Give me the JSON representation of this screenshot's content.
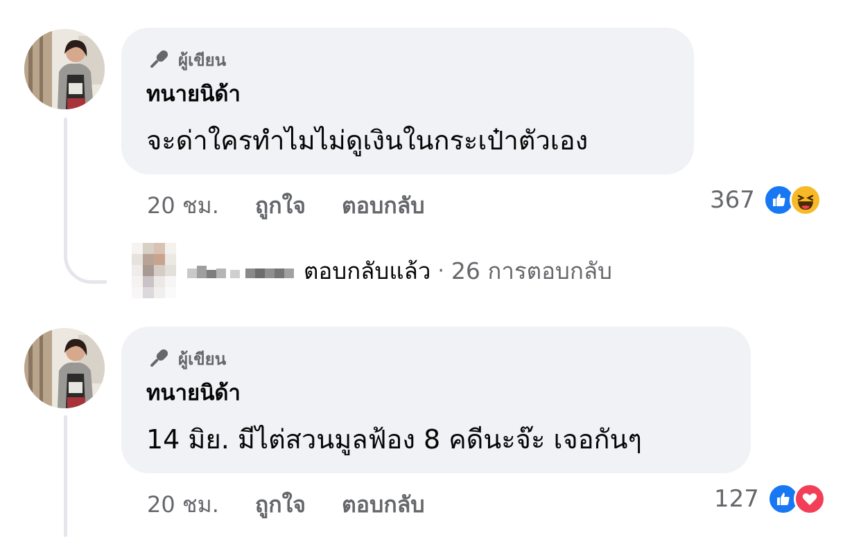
{
  "comments": [
    {
      "badge": "ผู้เขียน",
      "author": "ทนายนิด้า",
      "text": "จะด่าใครทำไมไม่ดูเงินในกระเป๋าตัวเอง",
      "time": "20 ชม.",
      "like_label": "ถูกใจ",
      "reply_label": "ตอบกลับ",
      "reaction_count": "367",
      "reactions": [
        "like-reaction-icon",
        "haha-reaction-icon"
      ]
    },
    {
      "badge": "ผู้เขียน",
      "author": "ทนายนิด้า",
      "text": "14 มิย. มีไต่สวนมูลฟ้อง 8 คดีนะจ๊ะ เจอกันๆ",
      "time": "20 ชม.",
      "like_label": "ถูกใจ",
      "reply_label": "ตอบกลับ",
      "reaction_count": "127",
      "reactions": [
        "like-reaction-icon",
        "love-reaction-icon"
      ]
    }
  ],
  "replies_summary": {
    "replied_text": "ตอบกลับแล้ว",
    "separator": "·",
    "count_text": "26 การตอบกลับ"
  },
  "colors": {
    "bubble_bg": "#f0f2f5",
    "muted_text": "#65676b",
    "like_blue": "#1877f2",
    "haha_yellow": "#f7b928",
    "love_red": "#f33e58",
    "thread_line": "#e4e6eb"
  }
}
